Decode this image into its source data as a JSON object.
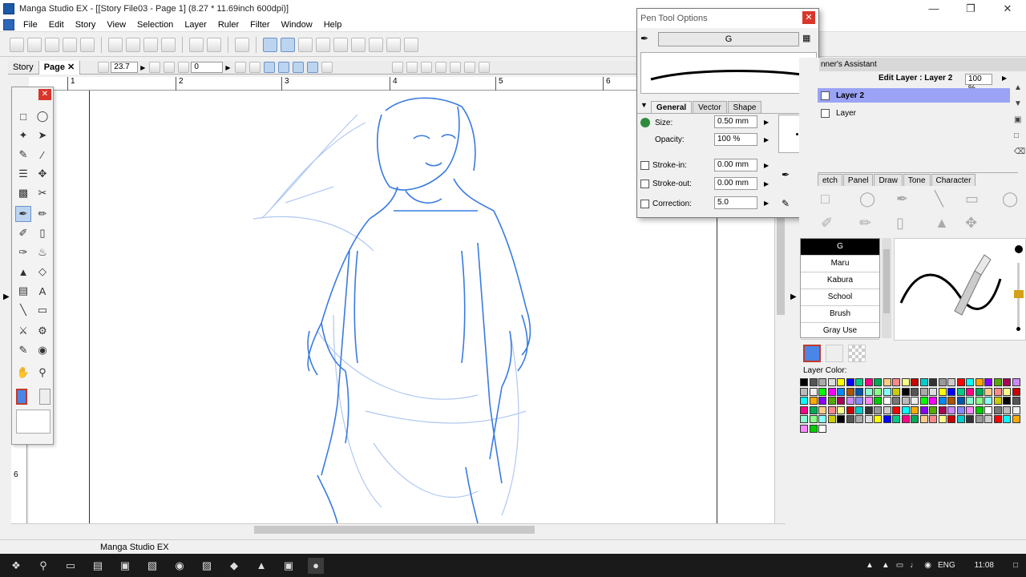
{
  "window": {
    "title": "Manga Studio EX - [[Story File03 - Page 1] (8.27 * 11.69inch 600dpi)]"
  },
  "menu": [
    "File",
    "Edit",
    "Story",
    "View",
    "Selection",
    "Layer",
    "Ruler",
    "Filter",
    "Window",
    "Help"
  ],
  "tabs": {
    "story": "Story",
    "page": "Page",
    "zoom": "23.7",
    "rotation": "0"
  },
  "ruler": {
    "top": [
      "1",
      "2",
      "3",
      "4",
      "5",
      "6"
    ],
    "left": [
      "1",
      "2",
      "3",
      "4",
      "5",
      "6"
    ]
  },
  "pen_tool_options": {
    "title": "Pen Tool Options",
    "brush_name": "G",
    "tabs": [
      "General",
      "Vector",
      "Shape"
    ],
    "size_label": "Size:",
    "size": "0.50 mm",
    "opacity_label": "Opacity:",
    "opacity": "100 %",
    "stroke_in_label": "Stroke-in:",
    "stroke_in": "0.00 mm",
    "stroke_out_label": "Stroke-out:",
    "stroke_out": "0.00 mm",
    "correction_label": "Correction:",
    "correction": "5.0"
  },
  "layers_panel": {
    "title": "nner's Assistant",
    "edit_layer": "Edit Layer : Layer 2",
    "opacity": "100 %",
    "layers": [
      "Layer 2",
      "Layer"
    ]
  },
  "materials_tabs": [
    "etch",
    "Panel",
    "Draw",
    "Tone",
    "Character"
  ],
  "brushes": [
    "G",
    "Maru",
    "Kabura",
    "School",
    "Brush",
    "Gray Use"
  ],
  "layer_color_label": "Layer Color:",
  "colors": {
    "accent": "#4a86e8",
    "sketch": "#3a7be0",
    "close": "#d9362b",
    "selected_layer": "#9aa3f5"
  },
  "status": "Manga Studio EX",
  "taskbar": {
    "lang": "ENG",
    "time": "11:08"
  }
}
